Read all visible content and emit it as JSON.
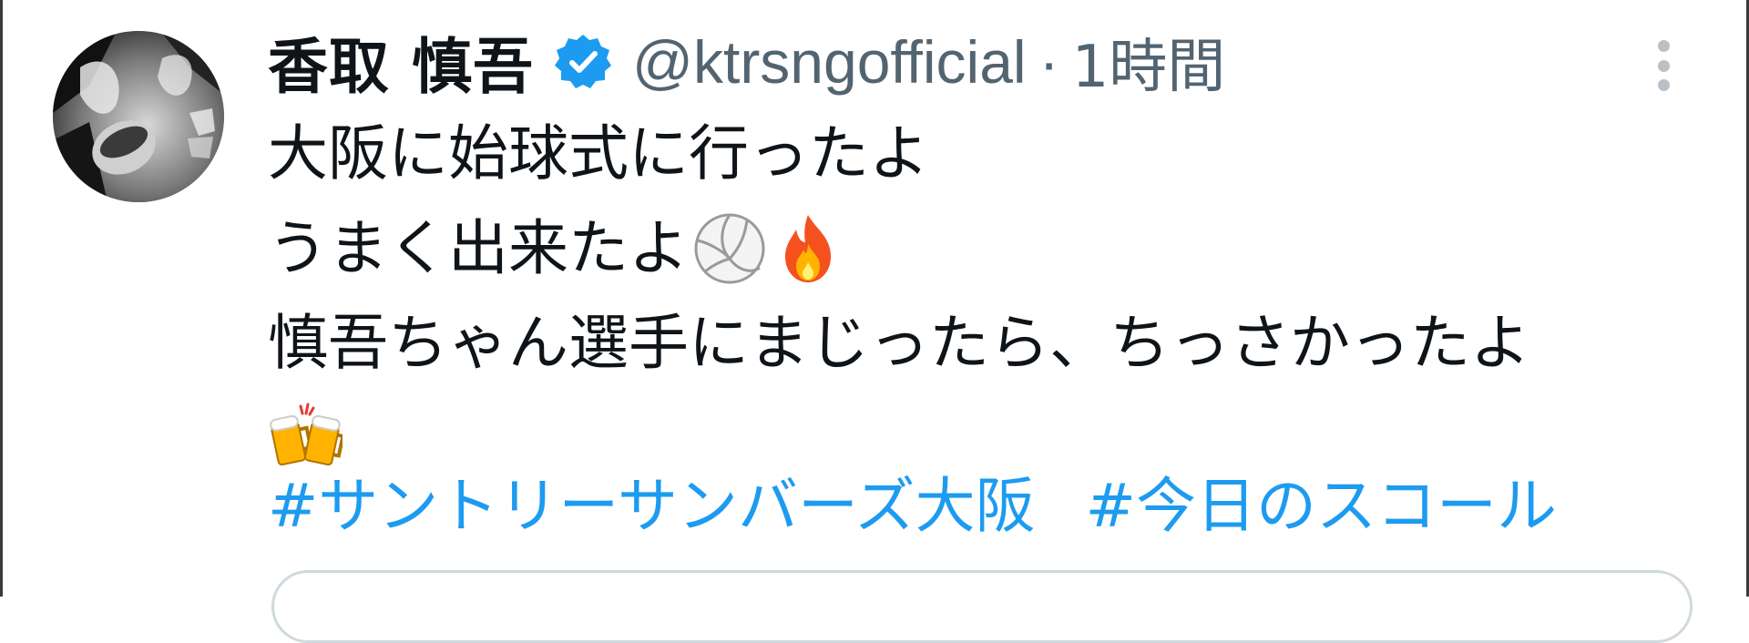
{
  "tweet": {
    "author": {
      "display_name": "香取 慎吾",
      "verified": true,
      "handle": "@ktrsngofficial",
      "avatar_icon": "profile-photo"
    },
    "separator": "·",
    "timestamp": "1時間",
    "more_icon": "more-vertical-icon",
    "text_lines": [
      "大阪に始球式に行ったよ",
      "うまく出来たよ",
      "慎吾ちゃん選手にまじったら、ちっさかったよ"
    ],
    "emojis": [
      "volleyball-emoji",
      "fire-emoji",
      "clinking-beer-mugs-emoji"
    ],
    "hashtags": [
      "#サントリーサンバーズ大阪",
      "#今日のスコール"
    ],
    "colors": {
      "text": "#0f1419",
      "secondary": "#536471",
      "link": "#1d9bf0",
      "verified_badge": "#1d9bf0"
    }
  }
}
